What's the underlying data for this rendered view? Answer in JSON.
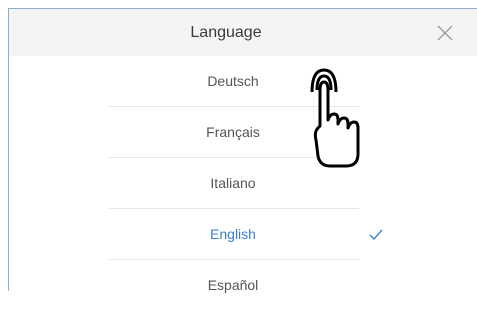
{
  "dialog": {
    "title": "Language",
    "close_icon": "close-icon"
  },
  "languages": [
    {
      "label": "Deutsch",
      "selected": false
    },
    {
      "label": "Français",
      "selected": false
    },
    {
      "label": "Italiano",
      "selected": false
    },
    {
      "label": "English",
      "selected": true
    },
    {
      "label": "Español",
      "selected": false
    }
  ],
  "selected_check_icon": "checkmark-icon",
  "gesture_icon": "tap-hand-icon",
  "colors": {
    "selected_text": "#3b7fd0",
    "header_bg": "#f4f4f4",
    "text": "#555555"
  }
}
